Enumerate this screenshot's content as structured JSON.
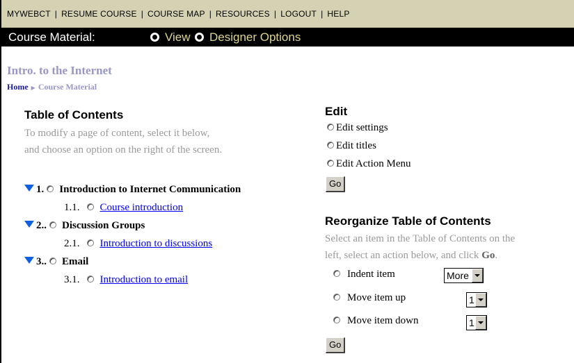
{
  "topnav": {
    "items": [
      {
        "label": "MYWEBCT"
      },
      {
        "label": "RESUME COURSE"
      },
      {
        "label": "COURSE MAP"
      },
      {
        "label": "RESOURCES"
      },
      {
        "label": "LOGOUT"
      },
      {
        "label": "HELP"
      }
    ],
    "separator": "|"
  },
  "material_bar": {
    "label": "Course Material:",
    "view_label": "View",
    "designer_label": "Designer Options",
    "selected": "Designer Options"
  },
  "course": {
    "title": "Intro. to the Internet",
    "breadcrumb": {
      "home": "Home",
      "current": "Course Material"
    }
  },
  "toc": {
    "heading": "Table of Contents",
    "hint_line1": "To modify a page of content, select it below,",
    "hint_line2": "and choose an option on the right of the screen.",
    "items": [
      {
        "number": "1.",
        "title": "Introduction to Internet Communication",
        "child": {
          "number": "1.1.",
          "title": "Course introduction"
        }
      },
      {
        "number": "2..",
        "title": "Discussion Groups",
        "child": {
          "number": "2.1.",
          "title": "Introduction to discussions"
        }
      },
      {
        "number": "3..",
        "title": "Email",
        "child": {
          "number": "3.1.",
          "title": "Introduction to email"
        }
      }
    ]
  },
  "edit": {
    "heading": "Edit",
    "options": [
      "Edit settings",
      "Edit titles",
      "Edit Action Menu"
    ],
    "go_label": "Go"
  },
  "reorganize": {
    "heading": "Reorganize Table of Contents",
    "hint_line1": "Select an item in the Table of Contents on the",
    "hint_line2_pre": "left, select an action below, and click ",
    "hint_line2_bold": "Go",
    "hint_line2_post": ".",
    "actions": [
      {
        "label": "Indent item",
        "select_value": "More"
      },
      {
        "label": "Move item up",
        "select_value": "1"
      },
      {
        "label": "Move item down",
        "select_value": "1"
      }
    ],
    "go_label": "Go"
  },
  "colors": {
    "nav_bg": "#d4d2b3",
    "material_bar_bg": "#000000",
    "material_option_text": "#dcd690",
    "course_title": "#9a97c8",
    "link": "#0000ee",
    "expand_triangle": "#1060e0"
  },
  "icons": {
    "expand": "triangle-down-icon",
    "dropdown": "chevron-down-icon"
  }
}
